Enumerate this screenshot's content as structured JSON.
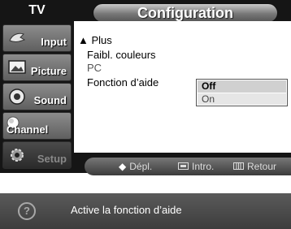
{
  "sidebar": {
    "header": "TV",
    "items": [
      {
        "label": "Input",
        "icon": "input-icon"
      },
      {
        "label": "Picture",
        "icon": "picture-icon"
      },
      {
        "label": "Sound",
        "icon": "sound-icon"
      },
      {
        "label": "Channel",
        "icon": "channel-icon"
      },
      {
        "label": "Setup",
        "icon": "setup-icon",
        "active": true
      }
    ]
  },
  "title": "Configuration",
  "menu": {
    "items": [
      {
        "label": "Plus",
        "prefix": "▲"
      },
      {
        "label": "Faibl. couleurs"
      },
      {
        "label": "PC"
      },
      {
        "label": "Fonction d’aide"
      }
    ],
    "options": [
      {
        "label": "Off",
        "selected": true
      },
      {
        "label": "On",
        "selected": false
      }
    ]
  },
  "hints": {
    "move": {
      "icon": "updown-icon",
      "label": "Dépl."
    },
    "enter": {
      "icon": "enter-icon",
      "label": "Intro."
    },
    "return": {
      "icon": "return-icon",
      "label": "Retour"
    }
  },
  "info": {
    "icon": "help-icon",
    "text": "Active la fonction d’aide"
  },
  "colors": {
    "background": "#151515",
    "accent": "#777777",
    "highlight": "#d0d0d0"
  }
}
